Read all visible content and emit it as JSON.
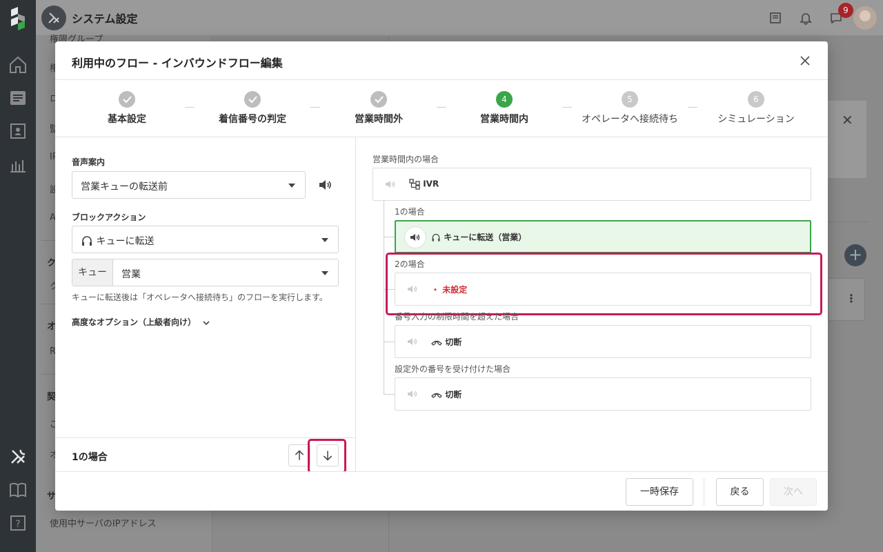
{
  "app": {
    "title": "システム設定",
    "notification_count": "9",
    "subnav": {
      "frag1": "権限グループ",
      "frag2": "権",
      "frag3": "ロ",
      "frag4": "監",
      "frag5": "IP",
      "frag6": "設",
      "frag7": "A",
      "head1": "ク",
      "frag8": "ク",
      "head2": "オ",
      "frag9": "R",
      "head3": "契",
      "frag10": "ご",
      "frag11": "オ",
      "head4": "サ",
      "last_item": "使用中サーバのIPアドレス"
    }
  },
  "modal": {
    "title": "利用中のフロー - インバウンドフロー編集",
    "steps": [
      {
        "label": "基本設定",
        "state": "done"
      },
      {
        "label": "着信番号の判定",
        "state": "done"
      },
      {
        "label": "営業時間外",
        "state": "done"
      },
      {
        "label": "営業時間内",
        "state": "active",
        "number": "4"
      },
      {
        "label": "オペレータへ接続待ち",
        "state": "pending",
        "number": "5"
      },
      {
        "label": "シミュレーション",
        "state": "pending",
        "number": "6"
      }
    ],
    "left": {
      "voice_label": "音声案内",
      "voice_value": "営業キューの転送前",
      "block_label": "ブロックアクション",
      "block_value": "キューに転送",
      "queue_addon": "キュー",
      "queue_value": "営業",
      "hint": "キューに転送後は「オペレータへ接続待ち」のフローを実行します。",
      "advanced": "高度なオプション（上級者向け）",
      "footer_case": "1の場合"
    },
    "right": {
      "root_label": "営業時間内の場合",
      "root_node": "IVR",
      "branches": [
        {
          "label": "1の場合",
          "node": "キューに転送（営業）"
        },
        {
          "label": "2の場合",
          "node": "未設定"
        },
        {
          "label": "番号入力の制限時間を超えた場合",
          "node": "切断"
        },
        {
          "label": "設定外の番号を受け付けた場合",
          "node": "切断"
        }
      ]
    },
    "footer": {
      "save_temp": "一時保存",
      "back": "戻る",
      "next": "次へ"
    }
  },
  "colors": {
    "accent_green": "#3aa648",
    "highlight": "#c8195b",
    "unset_red": "#d13036"
  }
}
